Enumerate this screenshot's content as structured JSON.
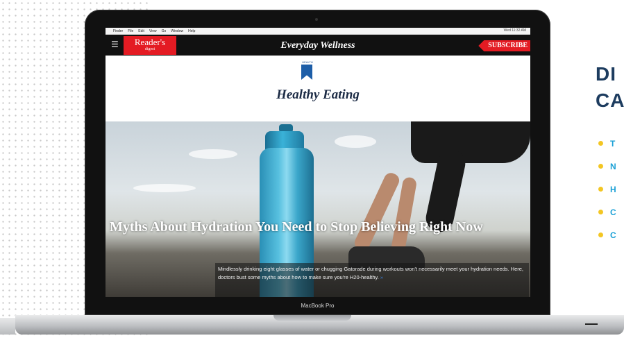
{
  "menubar": {
    "items": [
      "Finder",
      "File",
      "Edit",
      "View",
      "Go",
      "Window",
      "Help"
    ],
    "status": "Wed 11:32 AM"
  },
  "site": {
    "logo_line1": "Reader's",
    "logo_line2": "digest",
    "title": "Everyday Wellness",
    "subscribe_label": "SUBSCRIBE",
    "menu_icon": "☰"
  },
  "category": {
    "tag": "HEALTH",
    "title": "Healthy Eating"
  },
  "article": {
    "headline": "Myths About Hydration You Need to Stop Believing Right Now",
    "description": "Mindlessly drinking eight glasses of water or chugging Gatorade during workouts won't necessarily meet your hydration needs. Here, doctors bust some myths about how to make sure you're H20-healthy.",
    "arrow": "»"
  },
  "laptop": {
    "label": "MacBook Pro"
  },
  "sidebar_text": {
    "heading_line1": "DI",
    "heading_line2": "CA",
    "bullets": [
      "T",
      "N",
      "H",
      "C",
      "C"
    ]
  },
  "colors": {
    "brand_red": "#e41b23",
    "heading_navy": "#1d3c5f",
    "bullet_text": "#1aa0d6",
    "bullet_dot": "#f3c623"
  }
}
